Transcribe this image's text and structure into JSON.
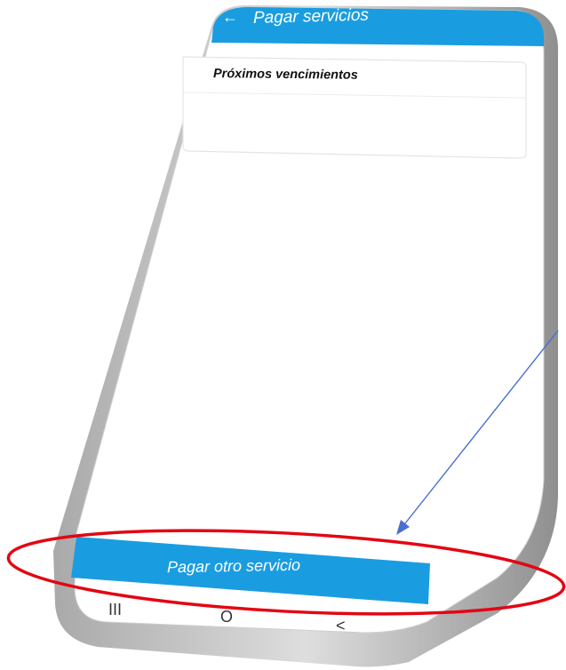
{
  "app": {
    "header_title": "Pagar servicios",
    "back_icon": "arrow-left-icon"
  },
  "upcoming": {
    "title": "Próximos vencimientos"
  },
  "cta": {
    "label": "Pagar otro servicio"
  },
  "system_nav": {
    "recents_glyph": "III",
    "home_glyph": "O",
    "back_glyph": "<"
  },
  "colors": {
    "primary": "#1a9de0",
    "annotation_red": "#e30613",
    "annotation_blue": "#4a6fd0"
  }
}
